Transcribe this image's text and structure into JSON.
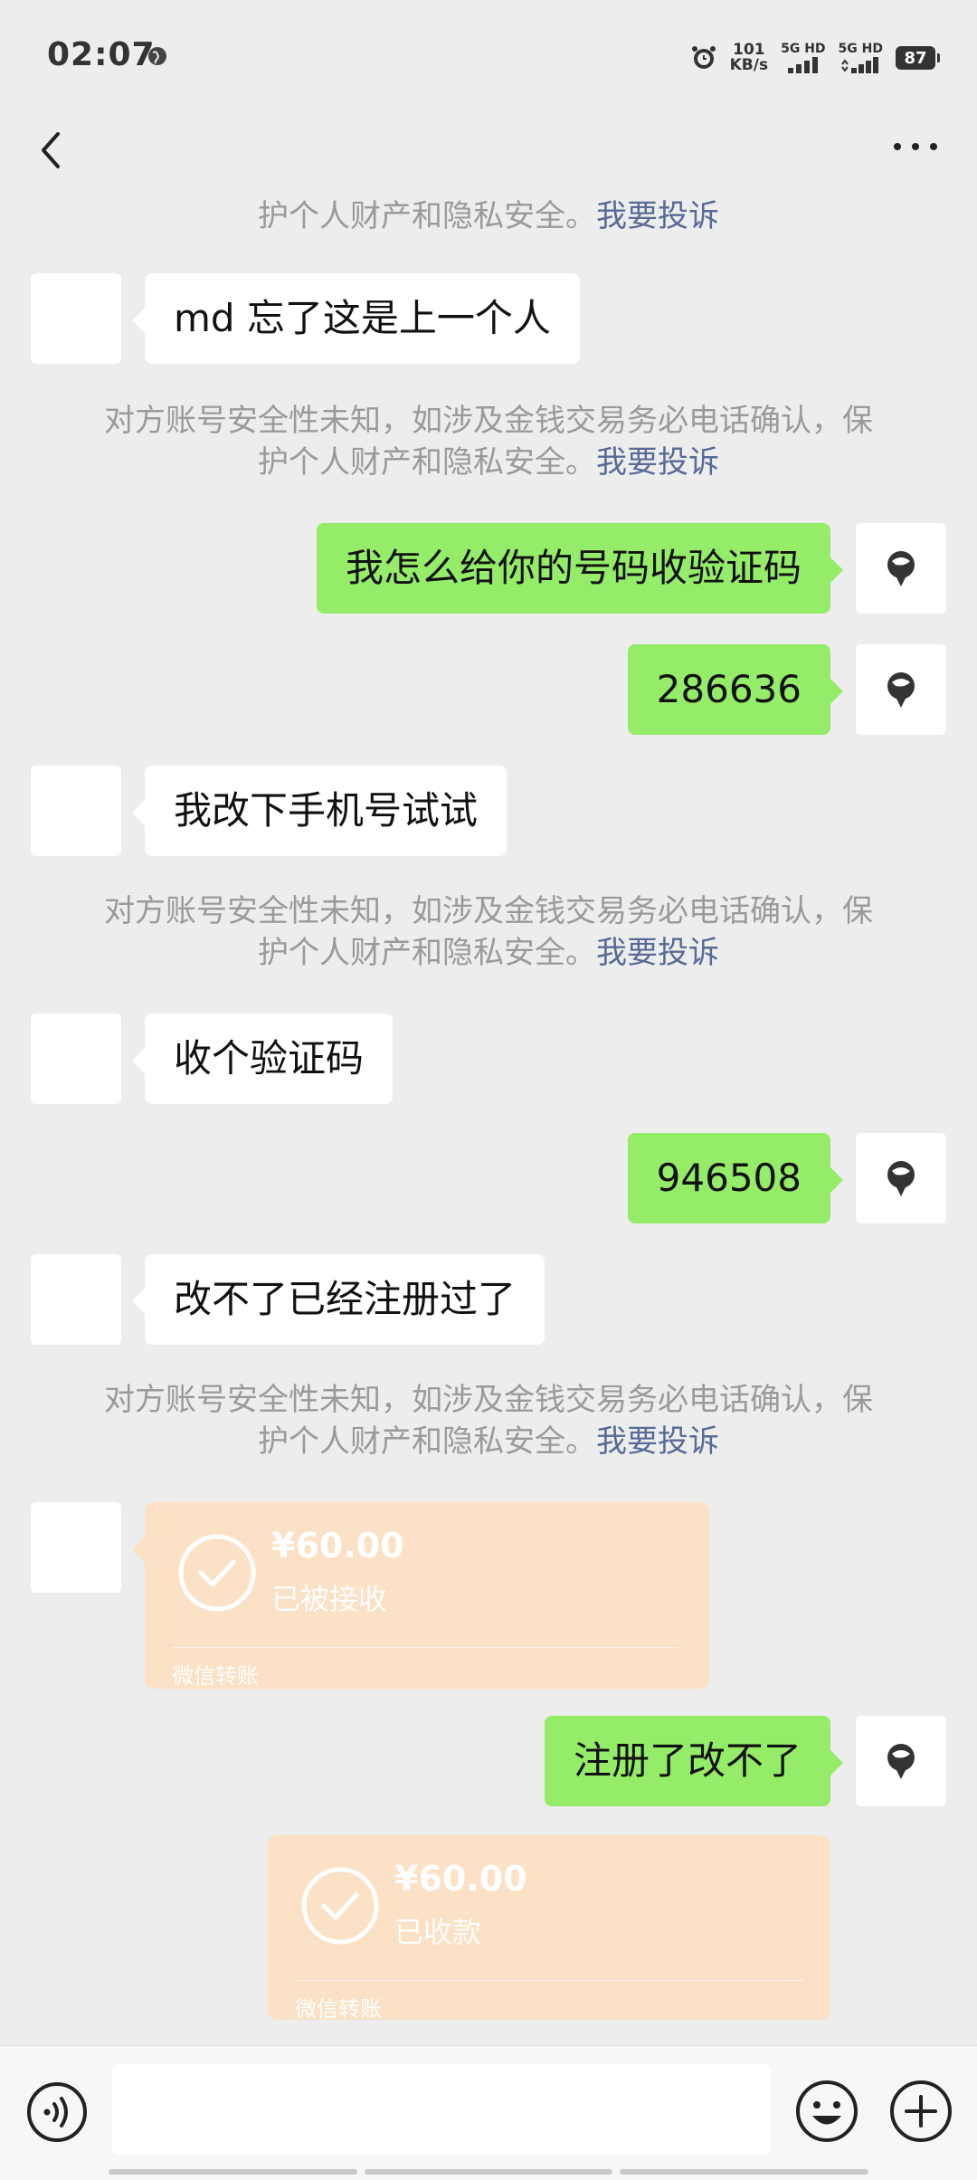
{
  "status_bar": {
    "time": "02:07",
    "net_speed_value": "101",
    "net_speed_unit": "KB/s",
    "sim1": "5G HD",
    "sim2": "5G HD",
    "battery": "87"
  },
  "notice": {
    "line1": "对方账号安全性未知，如涉及金钱交易务必电话确认，保",
    "line2_prefix": "护个人财产和隐私安全。",
    "complaint_link": "我要投诉"
  },
  "messages": {
    "m1": "md 忘了这是上一个人",
    "m2": "我怎么给你的号码收验证码",
    "m3": "286636",
    "m4": "我改下手机号试试",
    "m5": "收个验证码",
    "m6": "946508",
    "m7": "改不了已经注册过了",
    "m8": "注册了改不了"
  },
  "transfers": {
    "t1": {
      "amount": "¥60.00",
      "status": "已被接收",
      "footer": "微信转账"
    },
    "t2": {
      "amount": "¥60.00",
      "status": "已收款",
      "footer": "微信转账"
    }
  },
  "icons": {
    "back": "back-arrow-icon",
    "more": "more-icon",
    "voice": "voice-icon",
    "emoji": "emoji-icon",
    "plus": "plus-icon"
  },
  "colors": {
    "outgoing_bubble": "#95ec69",
    "incoming_bubble": "#ffffff",
    "transfer_card": "#fbe1c5",
    "link": "#576b95",
    "background": "#ededed"
  }
}
